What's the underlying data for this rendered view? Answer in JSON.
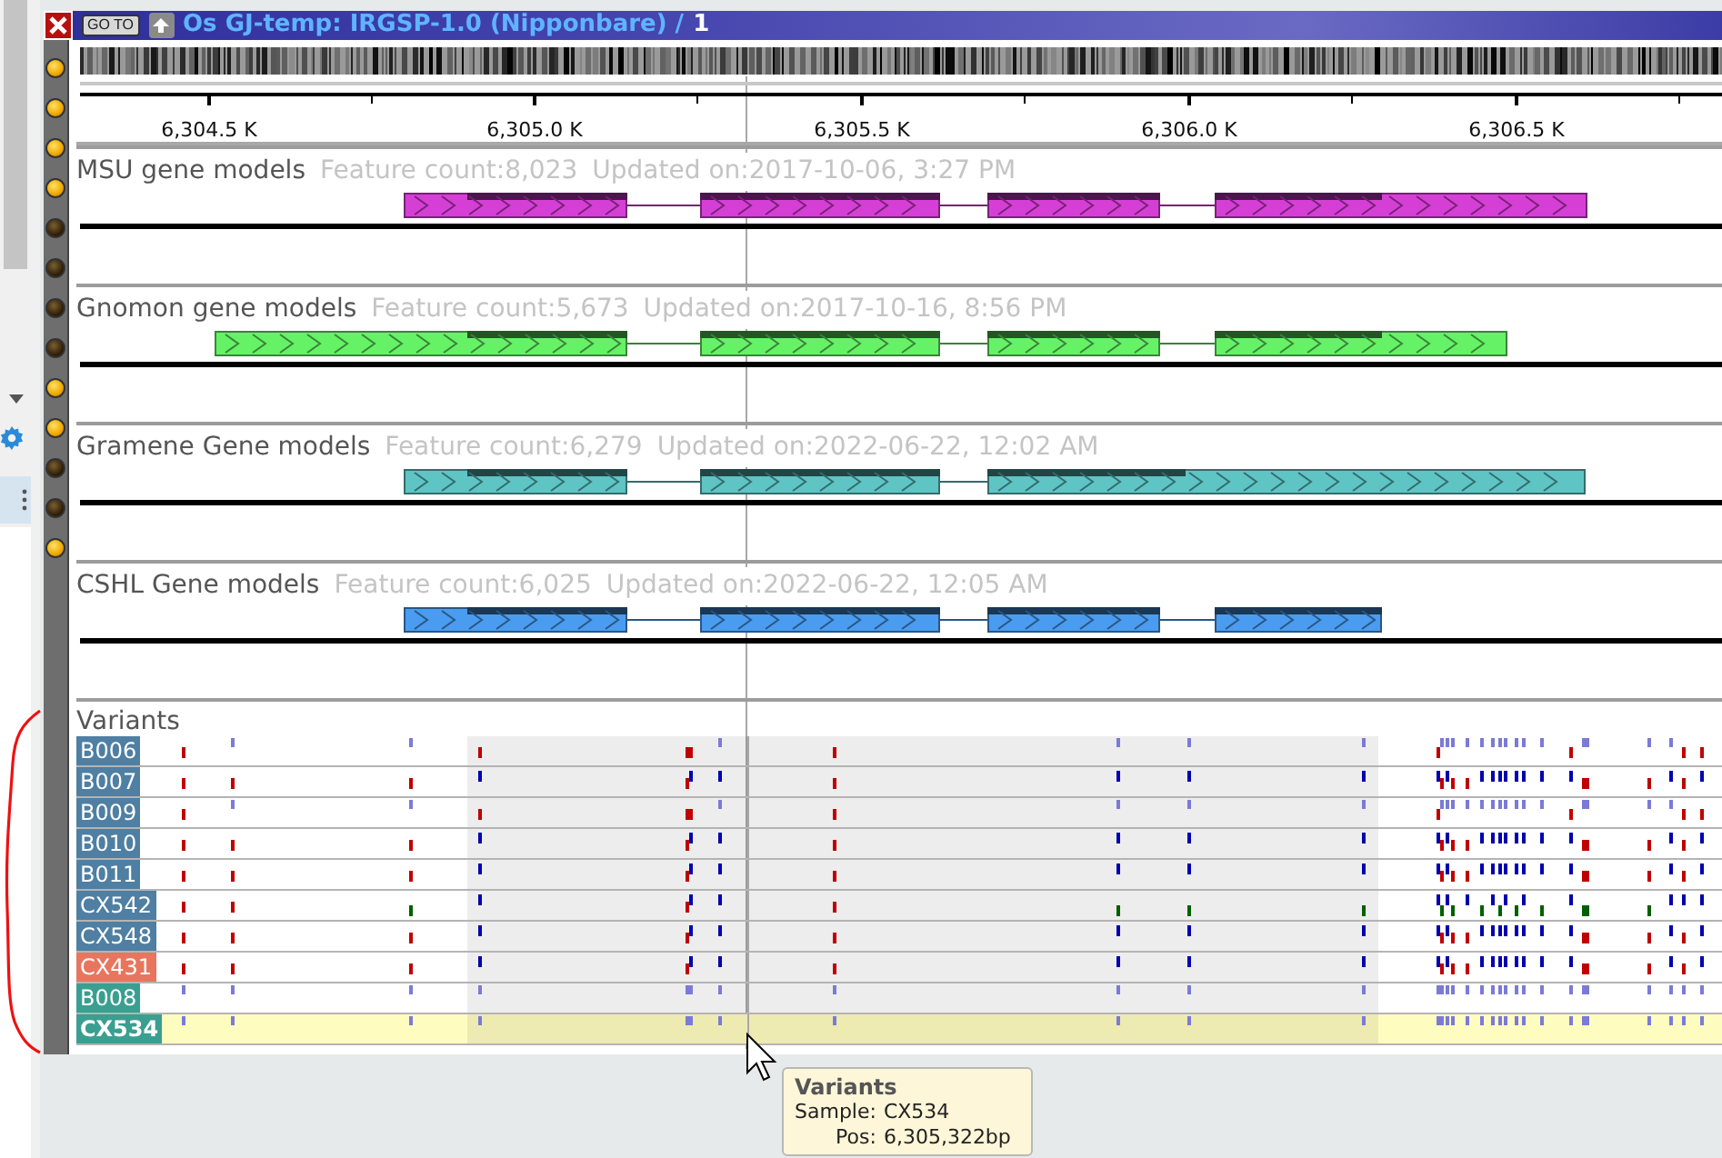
{
  "window": {
    "title": "Os GJ-temp: IRGSP-1.0 (Nipponbare) /",
    "page": "1"
  },
  "toolbar": {
    "goto_button": "GO TO"
  },
  "track_toggles": [
    {
      "on": true
    },
    {
      "on": true
    },
    {
      "on": true
    },
    {
      "on": true
    },
    {
      "on": false
    },
    {
      "on": false
    },
    {
      "on": false
    },
    {
      "on": false
    },
    {
      "on": true
    },
    {
      "on": true
    },
    {
      "on": false
    },
    {
      "on": false
    },
    {
      "on": true
    }
  ],
  "ruler": {
    "labels": [
      "6,304.5 K",
      "6,305.0 K",
      "6,305.5 K",
      "6,306.0 K",
      "6,306.5 K"
    ]
  },
  "tracks": [
    {
      "name": "MSU gene models",
      "feature_count": "Feature count:8,023",
      "updated": "Updated on:2017-10-06, 3:27 PM",
      "color": "#d63fd6"
    },
    {
      "name": "Gnomon gene models",
      "feature_count": "Feature count:5,673",
      "updated": "Updated on:2017-10-16, 8:56 PM",
      "color": "#66f266"
    },
    {
      "name": "Gramene Gene models",
      "feature_count": "Feature count:6,279",
      "updated": "Updated on:2022-06-22, 12:02 AM",
      "color": "#5fc4c4"
    },
    {
      "name": "CSHL Gene models",
      "feature_count": "Feature count:6,025",
      "updated": "Updated on:2022-06-22, 12:05 AM",
      "color": "#4a9cf0"
    }
  ],
  "variants": {
    "title": "Variants",
    "samples": [
      {
        "name": "B006",
        "color": "#4f7fa3",
        "selected": false
      },
      {
        "name": "B007",
        "color": "#4f7fa3",
        "selected": false
      },
      {
        "name": "B009",
        "color": "#4f7fa3",
        "selected": false
      },
      {
        "name": "B010",
        "color": "#4f7fa3",
        "selected": false
      },
      {
        "name": "B011",
        "color": "#4f7fa3",
        "selected": false
      },
      {
        "name": "CX542",
        "color": "#4f7fa3",
        "selected": false
      },
      {
        "name": "CX548",
        "color": "#4f7fa3",
        "selected": false
      },
      {
        "name": "CX431",
        "color": "#e8765f",
        "selected": false
      },
      {
        "name": "B008",
        "color": "#3a9f90",
        "selected": false
      },
      {
        "name": "CX534",
        "color": "#3a9f90",
        "selected": true
      }
    ]
  },
  "tooltip": {
    "title": "Variants",
    "fields": [
      {
        "label": "Sample:",
        "value": "CX534"
      },
      {
        "label": "Pos:",
        "value": "6,305,322bp"
      }
    ]
  }
}
